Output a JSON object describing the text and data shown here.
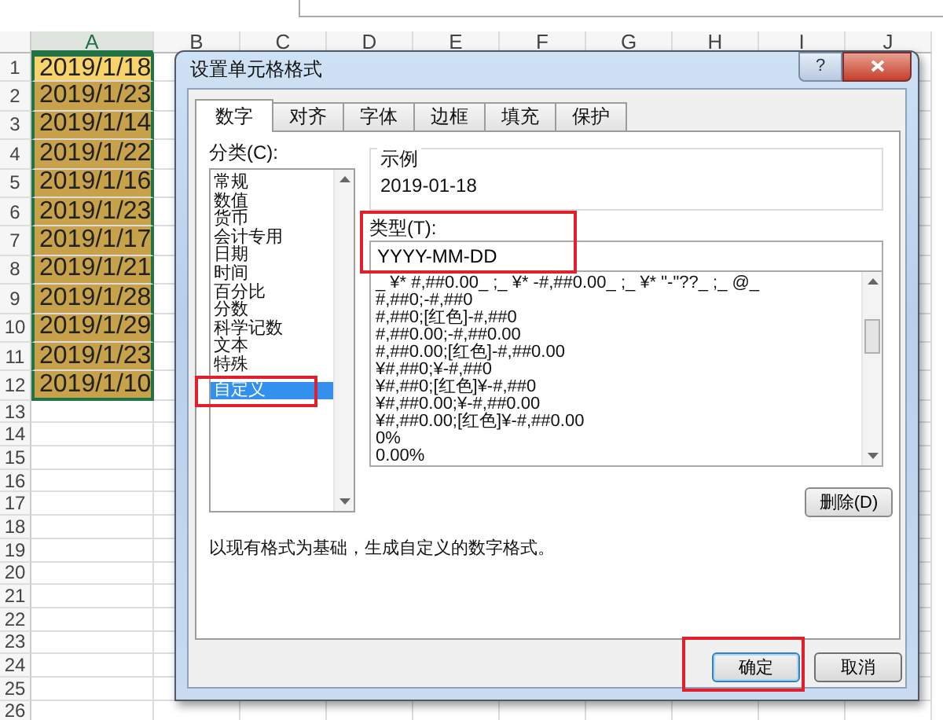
{
  "sheet": {
    "columns": [
      {
        "label": "A",
        "selected": true
      },
      {
        "label": "B",
        "selected": false
      },
      {
        "label": "C",
        "selected": false
      },
      {
        "label": "D",
        "selected": false
      },
      {
        "label": "E",
        "selected": false
      },
      {
        "label": "F",
        "selected": false
      },
      {
        "label": "G",
        "selected": false
      },
      {
        "label": "H",
        "selected": false
      },
      {
        "label": "I",
        "selected": false
      },
      {
        "label": "J",
        "selected": false
      }
    ],
    "rows": [
      {
        "number": "1",
        "value": "2019/1/18",
        "selected": true,
        "active": true
      },
      {
        "number": "2",
        "value": "2019/1/23",
        "selected": true,
        "active": false
      },
      {
        "number": "3",
        "value": "2019/1/14",
        "selected": true,
        "active": false
      },
      {
        "number": "4",
        "value": "2019/1/22",
        "selected": true,
        "active": false
      },
      {
        "number": "5",
        "value": "2019/1/16",
        "selected": true,
        "active": false
      },
      {
        "number": "6",
        "value": "2019/1/23",
        "selected": true,
        "active": false
      },
      {
        "number": "7",
        "value": "2019/1/17",
        "selected": true,
        "active": false
      },
      {
        "number": "8",
        "value": "2019/1/21",
        "selected": true,
        "active": false
      },
      {
        "number": "9",
        "value": "2019/1/28",
        "selected": true,
        "active": false
      },
      {
        "number": "10",
        "value": "2019/1/29",
        "selected": true,
        "active": false
      },
      {
        "number": "11",
        "value": "2019/1/23",
        "selected": true,
        "active": false
      },
      {
        "number": "12",
        "value": "2019/1/10",
        "selected": true,
        "active": false
      },
      {
        "number": "13",
        "selected": false,
        "active": false
      },
      {
        "number": "14",
        "selected": false,
        "active": false
      },
      {
        "number": "15",
        "selected": false,
        "active": false
      },
      {
        "number": "16",
        "selected": false,
        "active": false
      },
      {
        "number": "17",
        "selected": false,
        "active": false
      },
      {
        "number": "18",
        "selected": false,
        "active": false
      },
      {
        "number": "19",
        "selected": false,
        "active": false
      },
      {
        "number": "20",
        "selected": false,
        "active": false
      },
      {
        "number": "21",
        "selected": false,
        "active": false
      },
      {
        "number": "22",
        "selected": false,
        "active": false
      },
      {
        "number": "23",
        "selected": false,
        "active": false
      },
      {
        "number": "24",
        "selected": false,
        "active": false
      },
      {
        "number": "25",
        "selected": false,
        "active": false
      },
      {
        "number": "26",
        "selected": false,
        "active": false
      }
    ]
  },
  "dialog": {
    "title": "设置单元格格式",
    "help_button": "?",
    "tabs": [
      {
        "label": "数字",
        "selected": true
      },
      {
        "label": "对齐",
        "selected": false
      },
      {
        "label": "字体",
        "selected": false
      },
      {
        "label": "边框",
        "selected": false
      },
      {
        "label": "填充",
        "selected": false
      },
      {
        "label": "保护",
        "selected": false
      }
    ],
    "category_label": "分类(C):",
    "categories": [
      {
        "label": "常规",
        "selected": false,
        "highlighted": false
      },
      {
        "label": "数值",
        "selected": false,
        "highlighted": false
      },
      {
        "label": "货币",
        "selected": false,
        "highlighted": false
      },
      {
        "label": "会计专用",
        "selected": false,
        "highlighted": false
      },
      {
        "label": "日期",
        "selected": false,
        "highlighted": false
      },
      {
        "label": "时间",
        "selected": false,
        "highlighted": false
      },
      {
        "label": "百分比",
        "selected": false,
        "highlighted": false
      },
      {
        "label": "分数",
        "selected": false,
        "highlighted": false
      },
      {
        "label": "科学记数",
        "selected": false,
        "highlighted": false
      },
      {
        "label": "文本",
        "selected": false,
        "highlighted": false
      },
      {
        "label": "特殊",
        "selected": false,
        "highlighted": false
      },
      {
        "label": "自定义",
        "selected": true,
        "highlighted": true
      }
    ],
    "sample_label": "示例",
    "sample_value": "2019-01-18",
    "type_label": "类型(T):",
    "type_value": "YYYY-MM-DD",
    "type_highlighted": true,
    "formats": [
      "_ ¥* #,##0.00_ ;_ ¥* -#,##0.00_ ;_ ¥* \"-\"??_ ;_ @_",
      "#,##0;-#,##0",
      "#,##0;[红色]-#,##0",
      "#,##0.00;-#,##0.00",
      "#,##0.00;[红色]-#,##0.00",
      "¥#,##0;¥-#,##0",
      "¥#,##0;[红色]¥-#,##0",
      "¥#,##0.00;¥-#,##0.00",
      "¥#,##0.00;[红色]¥-#,##0.00",
      "0%",
      "0.00%"
    ],
    "delete_button": "删除(D)",
    "description": "以现有格式为基础，生成自定义的数字格式。",
    "ok_button": {
      "label": "确定",
      "highlighted": true
    },
    "cancel_button": {
      "label": "取消"
    }
  }
}
